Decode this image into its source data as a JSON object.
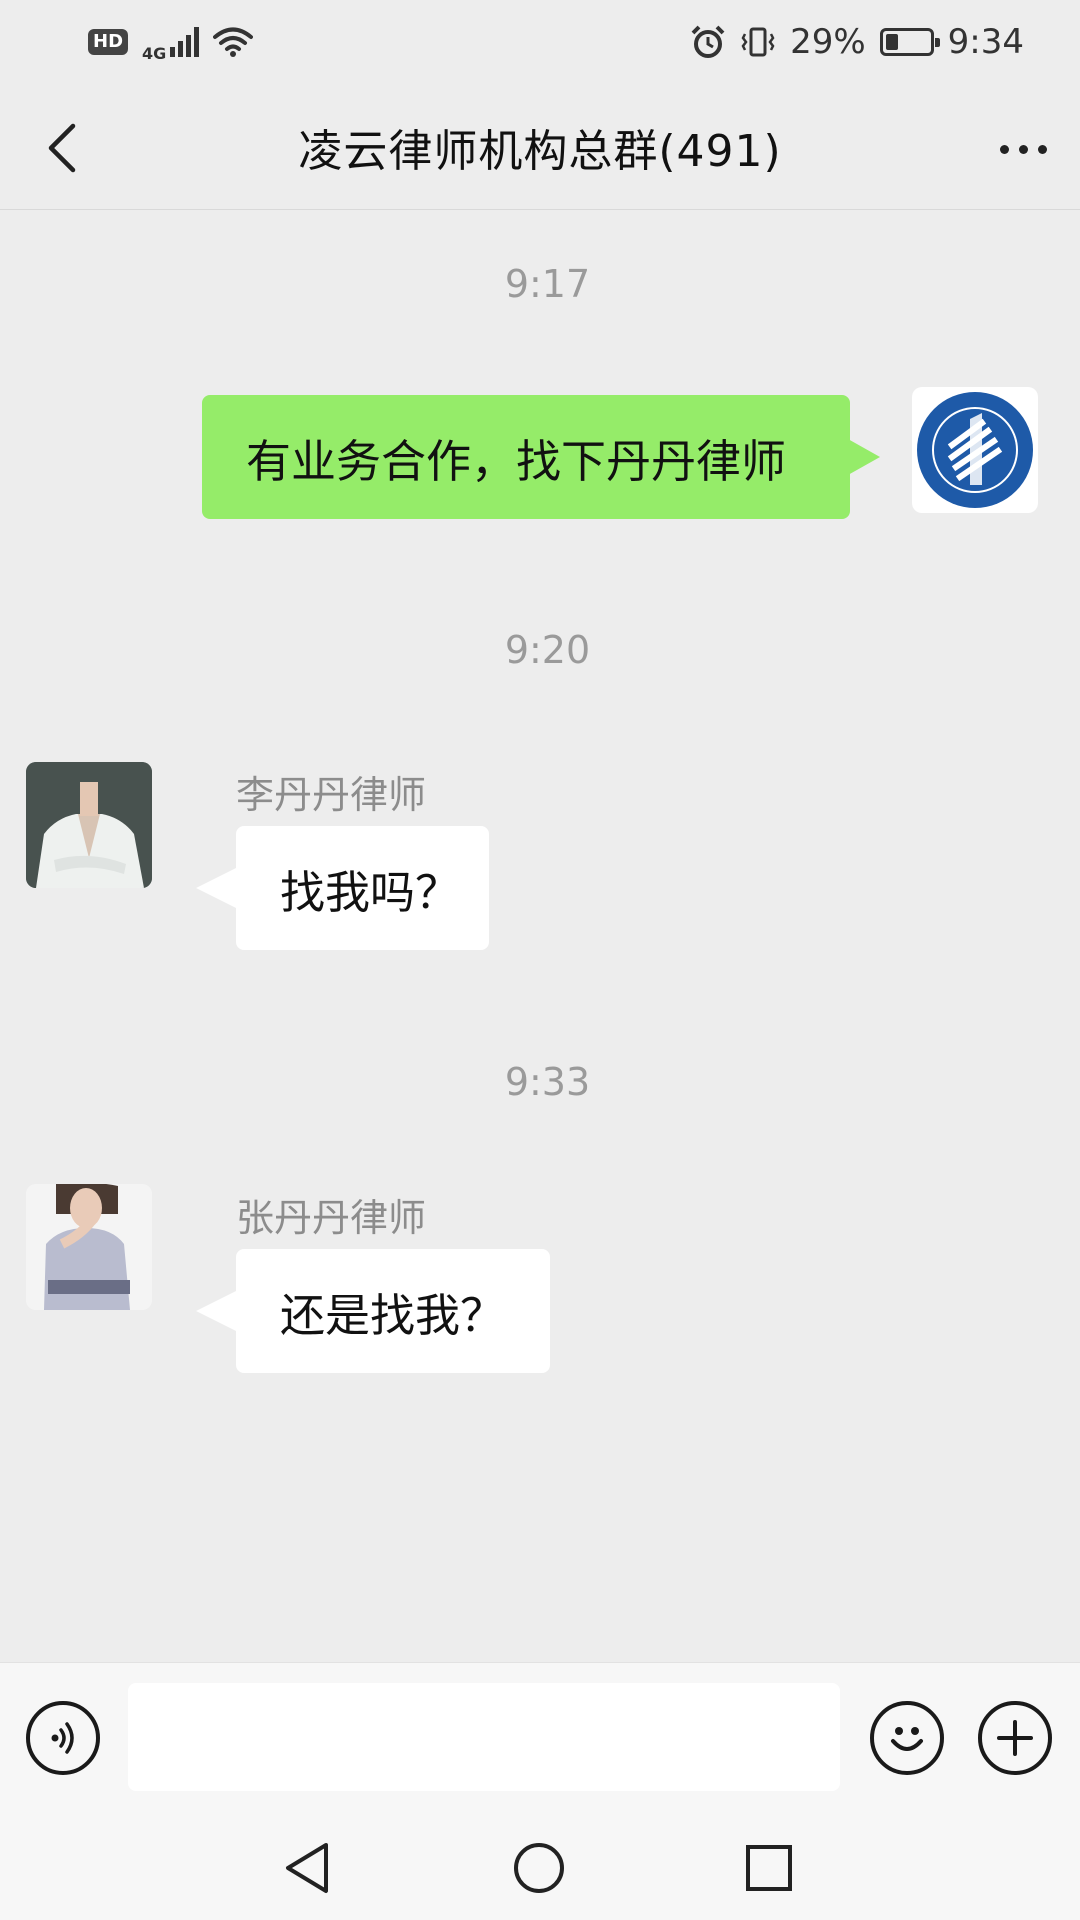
{
  "status_bar": {
    "hd_label": "HD",
    "network_type": "4G",
    "battery_percent": "29%",
    "battery_level": 0.29,
    "time": "9:34"
  },
  "header": {
    "title": "凌云律师机构总群(491)",
    "back_icon": "chevron-left-icon",
    "more_icon": "more-dots-icon"
  },
  "chat": {
    "messages": [
      {
        "timestamp": "9:17",
        "direction": "outgoing",
        "sender": "",
        "text": "有业务合作，找下丹丹律师",
        "avatar": "lingyun-law-firm-logo"
      },
      {
        "timestamp": "9:20",
        "direction": "incoming",
        "sender": "李丹丹律师",
        "text": "找我吗？",
        "avatar": "lawyer-photo-white-suit"
      },
      {
        "timestamp": "9:33",
        "direction": "incoming",
        "sender": "张丹丹律师",
        "text": "还是找我？",
        "avatar": "lawyer-photo-lavender-shirt"
      }
    ]
  },
  "input_bar": {
    "voice_icon": "voice-icon",
    "emoji_icon": "emoji-icon",
    "plus_icon": "plus-icon",
    "input_value": ""
  },
  "nav_bar": {
    "back_icon": "triangle-back-icon",
    "home_icon": "circle-home-icon",
    "recents_icon": "square-recents-icon"
  },
  "colors": {
    "outgoing_bubble": "#95ec69",
    "incoming_bubble": "#ffffff",
    "chat_background": "#ededed",
    "logo_blue": "#1e5aa8"
  }
}
